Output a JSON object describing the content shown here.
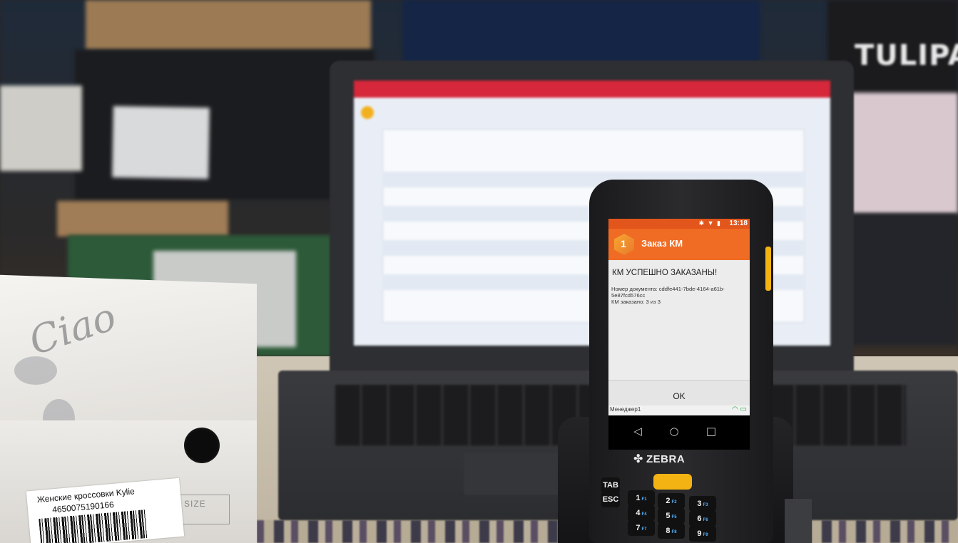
{
  "background": {
    "shelf_box_brand": "TULIPA"
  },
  "shoebox": {
    "label_title": "Женские кроссовки Kylie",
    "label_code": "4650075190166",
    "size_label": "SIZE"
  },
  "device": {
    "brand": "ZEBRA",
    "status_time": "13:18",
    "app_title": "Заказ КМ",
    "dialog_title": "КМ УСПЕШНО ЗАКАЗАНЫ!",
    "doc_line_1": "Номер документа: cddfe441-7bde-4164-a61b-",
    "doc_line_2": "5e87fcd576cc",
    "ordered_line": "КМ заказано: 3 из 3",
    "ok_label": "OK",
    "user_name": "Менеджер1",
    "nav": {
      "back_icon": "◁",
      "home_icon": "○",
      "recents_icon": "□"
    },
    "keys": [
      {
        "label": "TAB",
        "fn": ""
      },
      {
        "label": "ESC",
        "fn": ""
      },
      {
        "label": "1",
        "fn": "F1"
      },
      {
        "label": "2",
        "fn": "F2"
      },
      {
        "label": "3",
        "fn": "F3"
      },
      {
        "label": "4",
        "fn": "F4"
      },
      {
        "label": "5",
        "fn": "F5"
      },
      {
        "label": "6",
        "fn": "F6"
      },
      {
        "label": "7",
        "fn": "F7"
      },
      {
        "label": "8",
        "fn": "F8"
      },
      {
        "label": "9",
        "fn": "F9"
      }
    ],
    "colors": {
      "appbar": "#f06b23",
      "statusbar": "#e2561c",
      "scan_key": "#f2b313"
    }
  }
}
